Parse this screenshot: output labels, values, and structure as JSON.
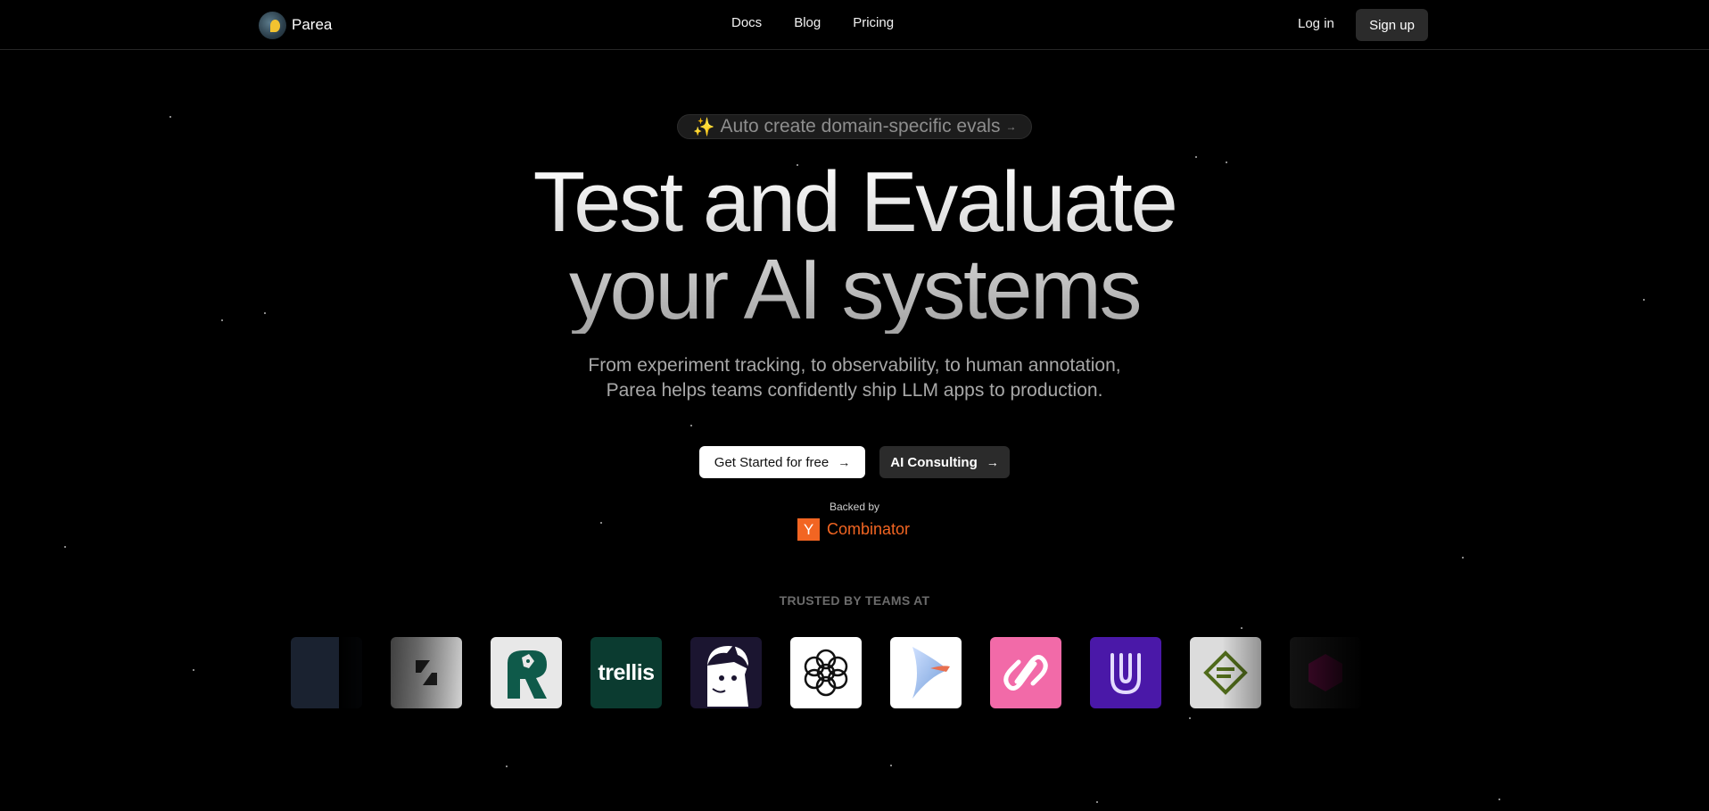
{
  "header": {
    "brand_name": "Parea",
    "nav": [
      {
        "label": "Docs"
      },
      {
        "label": "Blog"
      },
      {
        "label": "Pricing"
      }
    ],
    "login_label": "Log in",
    "signup_label": "Sign up"
  },
  "hero": {
    "pill_text": "Auto create domain-specific evals",
    "pill_icon": "sparkles-icon",
    "headline_line1": "Test and Evaluate",
    "headline_line2": "your AI systems",
    "subtitle_line1": "From experiment tracking, to observability, to human annotation,",
    "subtitle_line2": "Parea helps teams confidently ship LLM apps to production.",
    "cta_primary": "Get Started for free",
    "cta_secondary": "AI Consulting",
    "backed_by": "Backed by",
    "yc_letter": "Y",
    "yc_name": "Combinator"
  },
  "trusted": {
    "label": "TRUSTED BY TEAMS AT",
    "logo_word": "trellis",
    "logos": [
      {
        "icon": "partial-logo-icon"
      },
      {
        "icon": "s-mark-logo-icon"
      },
      {
        "icon": "green-r-fox-logo-icon"
      },
      {
        "icon": "trellis-logo-icon"
      },
      {
        "icon": "anime-character-logo-icon"
      },
      {
        "icon": "openai-flower-logo-icon"
      },
      {
        "icon": "blue-gradient-logo-icon"
      },
      {
        "icon": "pink-chain-logo-icon"
      },
      {
        "icon": "purple-u-logo-icon"
      },
      {
        "icon": "green-diamond-logo-icon"
      },
      {
        "icon": "magenta-hexagon-logo-icon"
      }
    ]
  },
  "colors": {
    "background": "#000000",
    "yc_orange": "#f26522",
    "button_dark": "#2b2b2b"
  }
}
